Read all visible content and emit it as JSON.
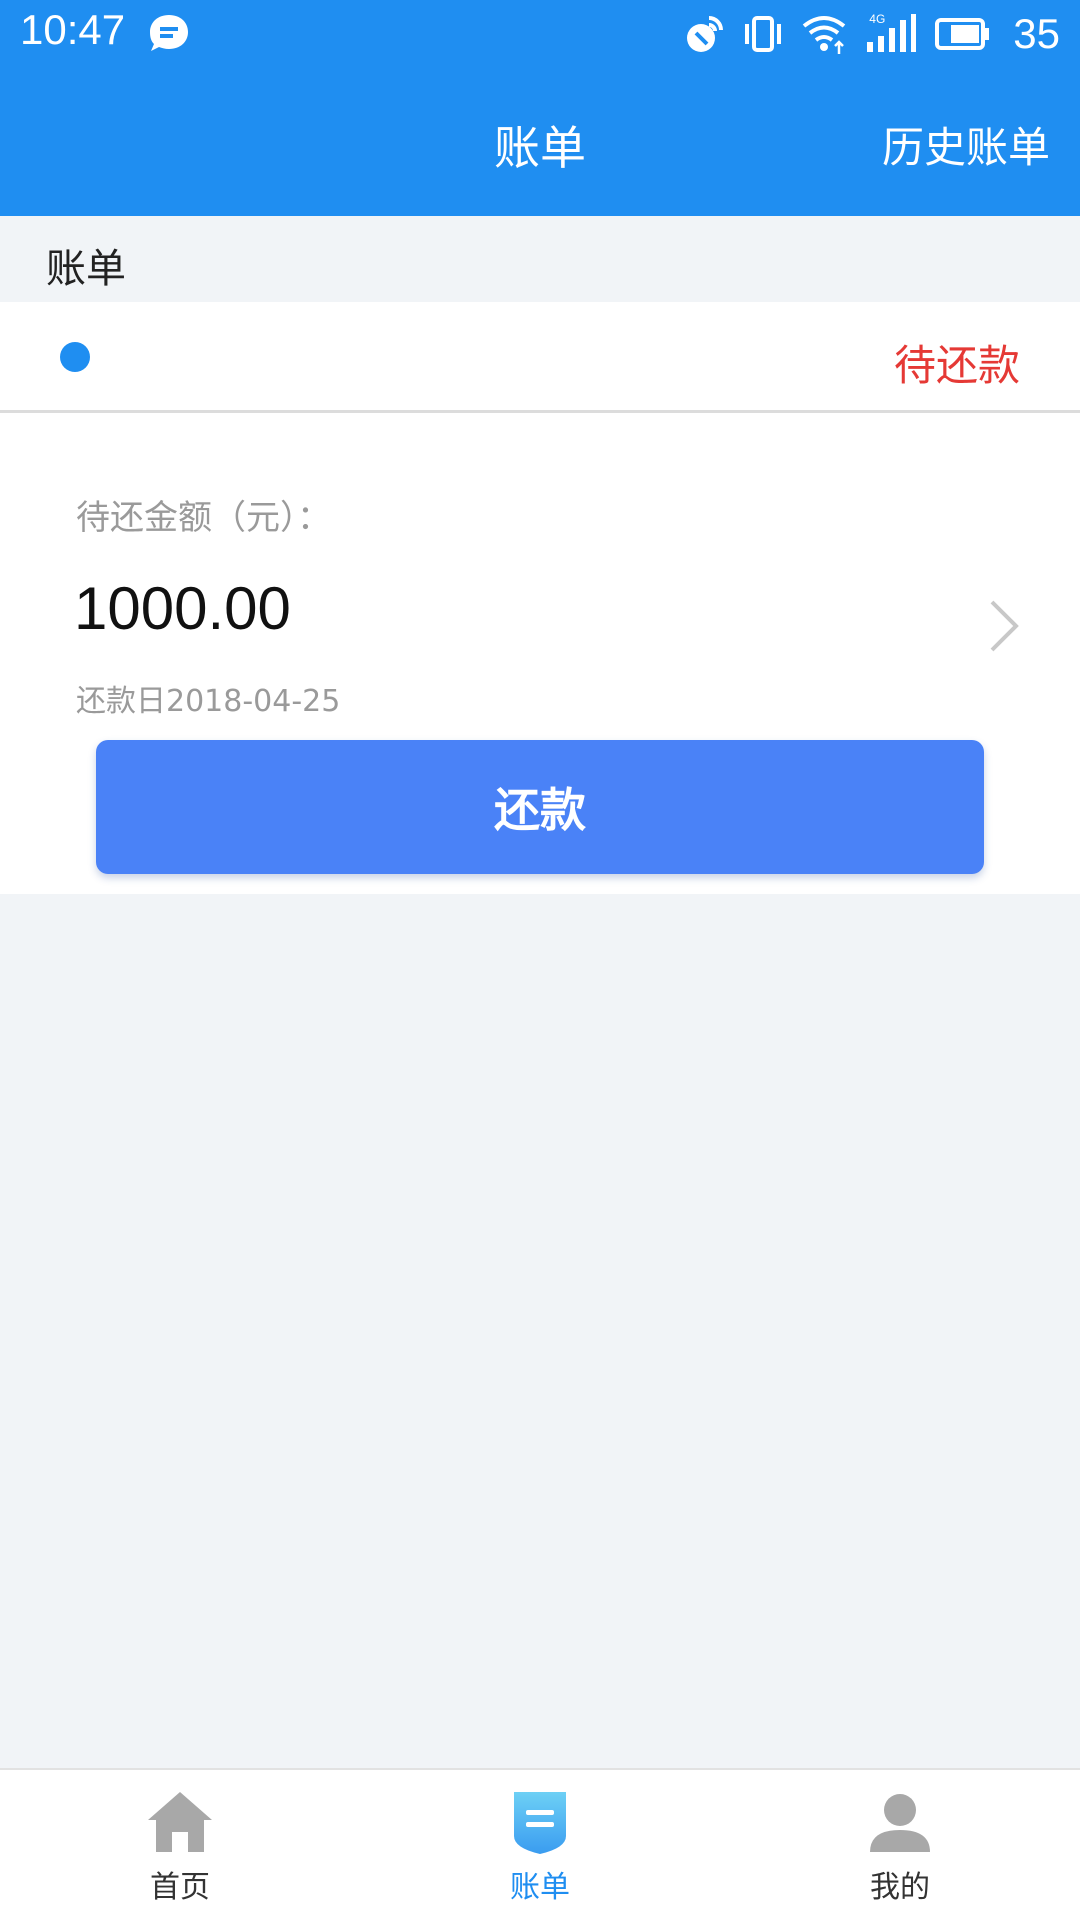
{
  "status_bar": {
    "time": "10:47",
    "battery_level": "35",
    "network_type": "4G",
    "icons": [
      "chat-bubble-icon",
      "location-icon",
      "vibrate-icon",
      "wifi-icon",
      "signal-icon",
      "battery-icon"
    ]
  },
  "header": {
    "title": "账单",
    "history_link": "历史账单"
  },
  "section": {
    "title": "账单"
  },
  "bill": {
    "status": "待还款",
    "amount_label": "待还金额（元）：",
    "amount": "1000.00",
    "due_date": "还款日2018-04-25",
    "repay_button": "还款"
  },
  "bottom_nav": {
    "items": [
      {
        "label": "首页",
        "icon": "home-icon",
        "active": false
      },
      {
        "label": "账单",
        "icon": "bill-icon",
        "active": true
      },
      {
        "label": "我的",
        "icon": "profile-icon",
        "active": false
      }
    ]
  },
  "colors": {
    "primary": "#1f8ef1",
    "button": "#4a82f7",
    "status_red": "#e53935",
    "background": "#f1f4f7"
  }
}
